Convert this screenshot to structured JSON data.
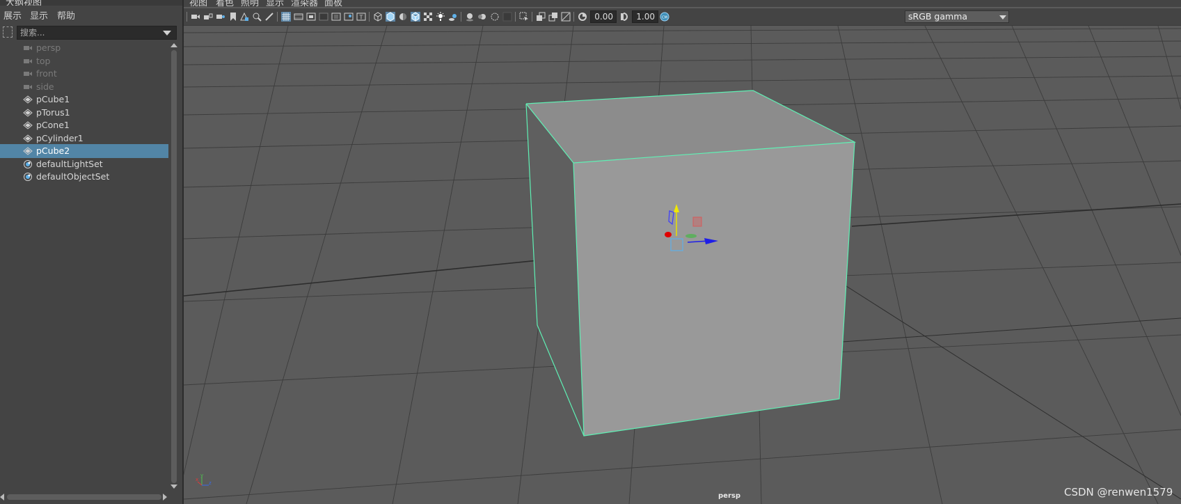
{
  "outliner": {
    "title": "大纲视图",
    "menu": [
      "展示",
      "显示",
      "帮助"
    ],
    "search": {
      "placeholder": "搜索...",
      "value": ""
    },
    "items": [
      {
        "label": "persp",
        "icon": "camera-icon",
        "dim": true,
        "selected": false
      },
      {
        "label": "top",
        "icon": "camera-icon",
        "dim": true,
        "selected": false
      },
      {
        "label": "front",
        "icon": "camera-icon",
        "dim": true,
        "selected": false
      },
      {
        "label": "side",
        "icon": "camera-icon",
        "dim": true,
        "selected": false
      },
      {
        "label": "pCube1",
        "icon": "mesh-icon",
        "dim": false,
        "selected": false
      },
      {
        "label": "pTorus1",
        "icon": "mesh-icon",
        "dim": false,
        "selected": false
      },
      {
        "label": "pCone1",
        "icon": "mesh-icon",
        "dim": false,
        "selected": false
      },
      {
        "label": "pCylinder1",
        "icon": "mesh-icon",
        "dim": false,
        "selected": false
      },
      {
        "label": "pCube2",
        "icon": "mesh-icon",
        "dim": false,
        "selected": true
      },
      {
        "label": "defaultLightSet",
        "icon": "set-icon",
        "dim": false,
        "selected": false
      },
      {
        "label": "defaultObjectSet",
        "icon": "set-icon",
        "dim": false,
        "selected": false
      }
    ]
  },
  "viewport": {
    "menu": [
      "视图",
      "着色",
      "照明",
      "显示",
      "渲染器",
      "面板"
    ],
    "toolbar": {
      "exposure": "0.00",
      "gamma": "1.00",
      "color_space": "sRGB gamma"
    },
    "camera": "persp",
    "selection_color": "#5ff0b4",
    "grid_color": "#3c3c3c"
  },
  "watermark": "CSDN @renwen1579"
}
